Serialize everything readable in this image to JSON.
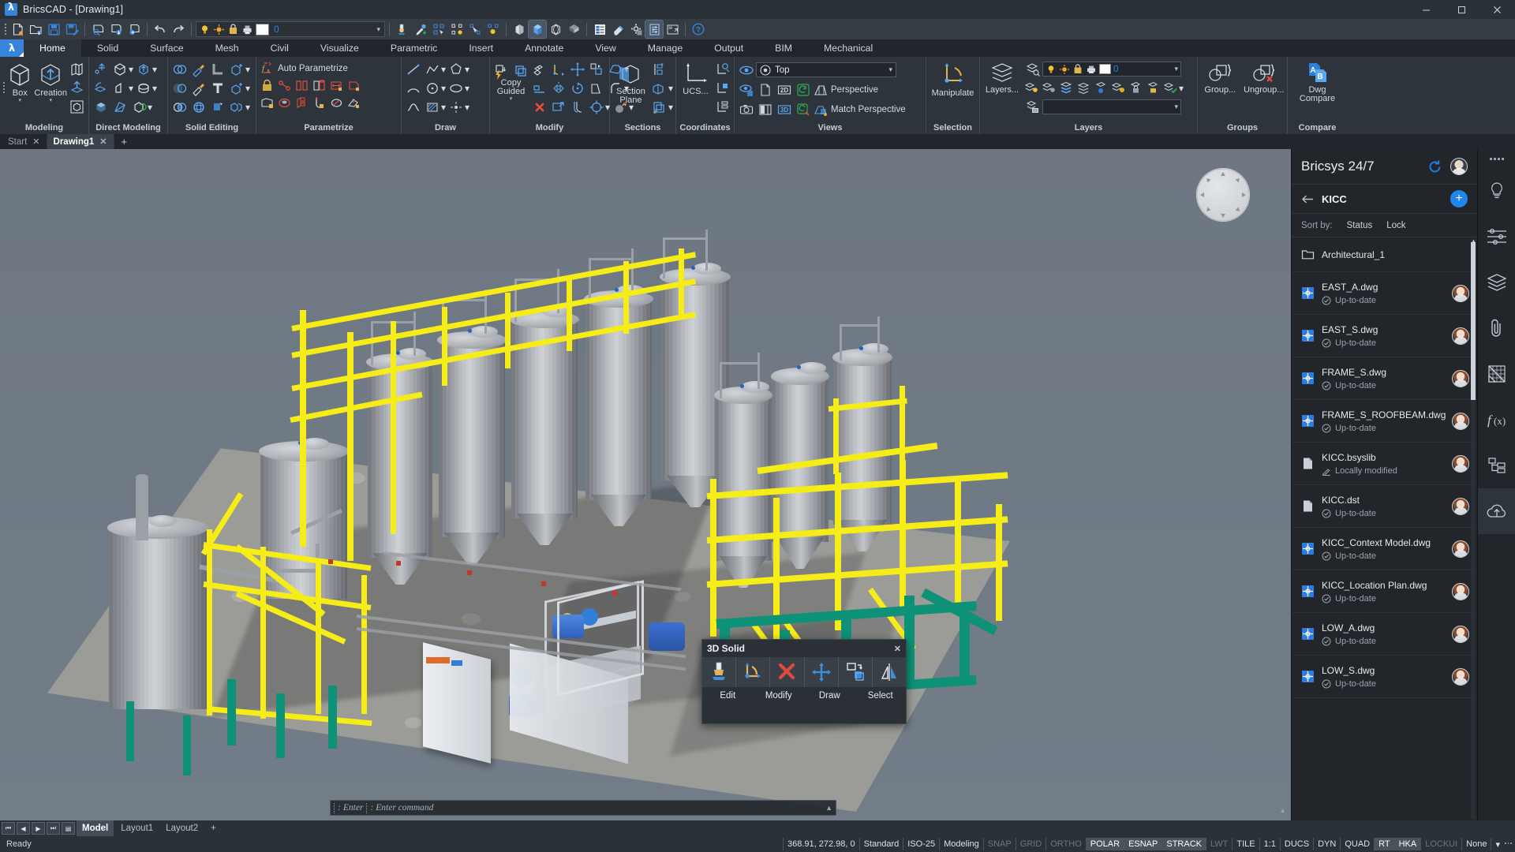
{
  "window": {
    "title": "BricsCAD - [Drawing1]",
    "minimize": "–",
    "maximize": "❐",
    "close": "✕"
  },
  "quick_access": {
    "layer_value": "0",
    "icons": [
      "new-drawing-icon",
      "open-drawing-icon",
      "save-icon",
      "save-as-icon",
      "plot-preview-icon",
      "plot-icon",
      "publish-icon",
      "undo-icon",
      "redo-icon",
      "layer-on-icon",
      "layer-freeze-icon",
      "layer-lock-icon",
      "layer-plot-icon",
      "match-properties-icon",
      "eyedropper-icon",
      "select-similar-icon",
      "select-all-icon",
      "quick-select-icon",
      "select-isolate-icon",
      "visual-style-2d-icon",
      "visual-style-3d-icon",
      "visual-style-wire-icon",
      "visual-style-shaded-icon",
      "properties-icon",
      "eraser-icon",
      "settings-icon",
      "customize-icon",
      "window-arrange-icon",
      "help-icon"
    ]
  },
  "ribbon": {
    "tabs": [
      "Home",
      "Solid",
      "Surface",
      "Mesh",
      "Civil",
      "Visualize",
      "Parametric",
      "Insert",
      "Annotate",
      "View",
      "Manage",
      "Output",
      "BIM",
      "Mechanical"
    ],
    "active_tab": "Home",
    "groups": [
      {
        "title": "Modeling",
        "buttons": [
          "Box",
          "Creation"
        ]
      },
      {
        "title": "Direct Modeling"
      },
      {
        "title": "Solid Editing"
      },
      {
        "title": "Parametrize",
        "auto_label": "Auto Parametrize"
      },
      {
        "title": "Draw"
      },
      {
        "title": "Modify",
        "copy_label": "Copy Guided"
      },
      {
        "title": "Sections",
        "section_label": "Section Plane"
      },
      {
        "title": "Coordinates",
        "ucs_label": "UCS..."
      },
      {
        "title": "Views",
        "view_value": "Top",
        "perspective": "Perspective",
        "match_perspective": "Match Perspective"
      },
      {
        "title": "Selection",
        "manipulate_label": "Manipulate"
      },
      {
        "title": "Layers",
        "layers_label": "Layers...",
        "layer_value": "0"
      },
      {
        "title": "Groups",
        "group_label": "Group...",
        "ungroup_label": "Ungroup..."
      },
      {
        "title": "Compare",
        "compare_label": "Dwg Compare"
      }
    ]
  },
  "doc_tabs": {
    "tabs": [
      {
        "label": "Start",
        "active": false
      },
      {
        "label": "Drawing1",
        "active": true
      }
    ],
    "close_glyph": "✕",
    "add_glyph": "+"
  },
  "solid_popup": {
    "title": "3D Solid",
    "close": "✕",
    "icons": [
      "paint-brush-icon",
      "angle-modify-icon",
      "delete-x-icon",
      "move-arrows-icon",
      "copy-select-icon",
      "mirror-icon"
    ],
    "labels": [
      "Edit",
      "Modify",
      "Draw",
      "Select"
    ]
  },
  "command_line": {
    "prompt_short": "Enter",
    "prompt_long": "Enter command",
    "expand_glyph": "▲"
  },
  "panel": {
    "title": "Bricsys 24/7",
    "refresh_icon": "refresh-icon",
    "user_avatar": "user-avatar",
    "back_icon": "back-arrow-icon",
    "project": "KICC",
    "add_glyph": "+",
    "sort_label": "Sort by:",
    "sort_options": [
      "Status",
      "Lock"
    ],
    "items": [
      {
        "name": "Architectural_1",
        "type": "folder",
        "status": null,
        "icon": "folder-icon"
      },
      {
        "name": "EAST_A.dwg",
        "type": "dwg",
        "status": "Up-to-date",
        "icon": "dwg-file-icon",
        "status_icon": "check-circle-icon"
      },
      {
        "name": "EAST_S.dwg",
        "type": "dwg",
        "status": "Up-to-date",
        "icon": "dwg-file-icon",
        "status_icon": "check-circle-icon"
      },
      {
        "name": "FRAME_S.dwg",
        "type": "dwg",
        "status": "Up-to-date",
        "icon": "dwg-file-icon",
        "status_icon": "check-circle-icon"
      },
      {
        "name": "FRAME_S_ROOFBEAM.dwg",
        "type": "dwg",
        "status": "Up-to-date",
        "icon": "dwg-file-icon",
        "status_icon": "check-circle-icon"
      },
      {
        "name": "KICC.bsyslib",
        "type": "file",
        "status": "Locally modified",
        "icon": "generic-file-icon",
        "status_icon": "pencil-icon"
      },
      {
        "name": "KICC.dst",
        "type": "file",
        "status": "Up-to-date",
        "icon": "generic-file-icon",
        "status_icon": "check-circle-icon"
      },
      {
        "name": "KICC_Context Model.dwg",
        "type": "dwg",
        "status": "Up-to-date",
        "icon": "dwg-file-icon",
        "status_icon": "check-circle-icon"
      },
      {
        "name": "KICC_Location Plan.dwg",
        "type": "dwg",
        "status": "Up-to-date",
        "icon": "dwg-file-icon",
        "status_icon": "check-circle-icon"
      },
      {
        "name": "LOW_A.dwg",
        "type": "dwg",
        "status": "Up-to-date",
        "icon": "dwg-file-icon",
        "status_icon": "check-circle-icon"
      },
      {
        "name": "LOW_S.dwg",
        "type": "dwg",
        "status": "Up-to-date",
        "icon": "dwg-file-icon",
        "status_icon": "check-circle-icon"
      }
    ]
  },
  "rail": {
    "icons": [
      "lightbulb-icon",
      "sliders-icon",
      "layers-stack-icon",
      "paperclip-icon",
      "grid-scale-icon",
      "fx-icon",
      "structure-tree-icon",
      "cloud-upload-icon"
    ],
    "active": "cloud-upload-icon"
  },
  "layout_bar": {
    "nav": [
      "⏮",
      "◀",
      "▶",
      "⏭",
      "▤"
    ],
    "tabs": [
      {
        "label": "Model",
        "active": true
      },
      {
        "label": "Layout1",
        "active": false
      },
      {
        "label": "Layout2",
        "active": false
      }
    ],
    "add_glyph": "+"
  },
  "status_bar": {
    "ready": "Ready",
    "coordinates": "368.91, 272.98, 0",
    "cells": [
      {
        "label": "Standard",
        "state": "normal"
      },
      {
        "label": "ISO-25",
        "state": "normal"
      },
      {
        "label": "Modeling",
        "state": "normal"
      },
      {
        "label": "SNAP",
        "state": "off"
      },
      {
        "label": "GRID",
        "state": "off"
      },
      {
        "label": "ORTHO",
        "state": "off"
      },
      {
        "label": "POLAR",
        "state": "on"
      },
      {
        "label": "ESNAP",
        "state": "on"
      },
      {
        "label": "STRACK",
        "state": "on"
      },
      {
        "label": "LWT",
        "state": "off"
      },
      {
        "label": "TILE",
        "state": "normal"
      },
      {
        "label": "1:1",
        "state": "normal"
      },
      {
        "label": "DUCS",
        "state": "normal"
      },
      {
        "label": "DYN",
        "state": "normal"
      },
      {
        "label": "QUAD",
        "state": "normal"
      },
      {
        "label": "RT",
        "state": "on"
      },
      {
        "label": "HKA",
        "state": "on"
      },
      {
        "label": "LOCKUI",
        "state": "off"
      },
      {
        "label": "None",
        "state": "normal"
      }
    ],
    "caret": "▾"
  },
  "colors": {
    "accent_blue": "#1f86ec",
    "yellow_rail": "#f6ec18",
    "teal_steel": "#0e9277",
    "titlebar": "#2b3138",
    "ribbon_bg": "#2e343b",
    "panel_bg": "#22262b"
  },
  "viewport": {
    "viewcube_name": "view-compass",
    "scene": "3D industrial brewery tank plant model"
  }
}
